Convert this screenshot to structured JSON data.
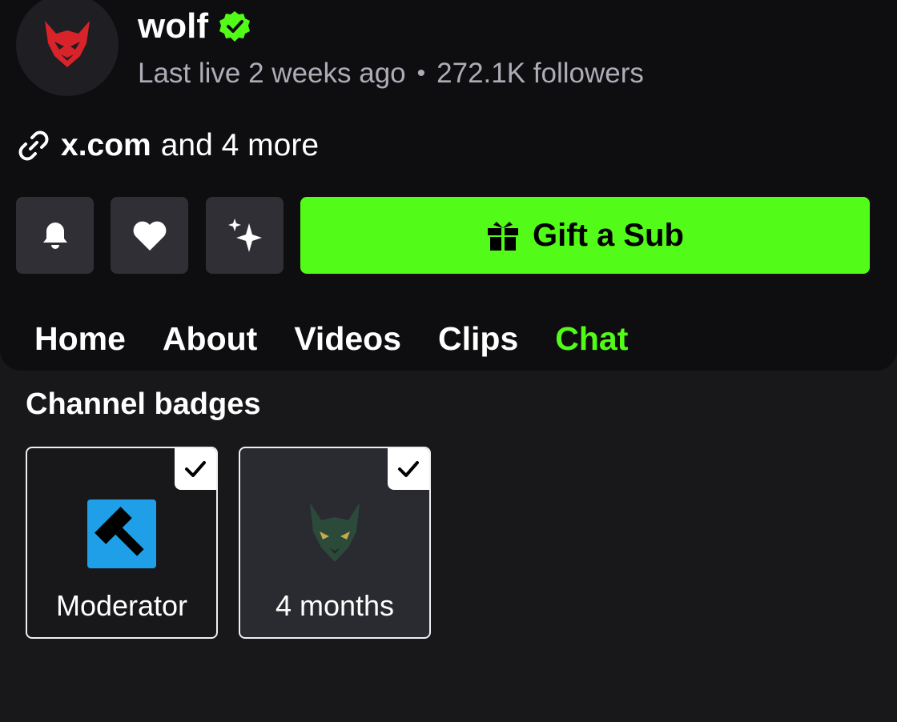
{
  "channel": {
    "name": "wolf",
    "last_live": "Last live 2 weeks ago",
    "separator": "•",
    "followers": "272.1K followers"
  },
  "links": {
    "primary": "x.com",
    "more": "and 4 more"
  },
  "actions": {
    "notify_icon": "bell-icon",
    "follow_icon": "heart-icon",
    "sparkle_icon": "sparkle-icon",
    "gift_label": "Gift a Sub",
    "gift_color": "#53fc18"
  },
  "tabs": [
    "Home",
    "About",
    "Videos",
    "Clips",
    "Chat"
  ],
  "active_tab": "Chat",
  "badges": {
    "title": "Channel badges",
    "items": [
      {
        "label": "Moderator",
        "icon": "hammer-icon",
        "selected": true
      },
      {
        "label": "4 months",
        "icon": "wolf-badge-icon",
        "selected": true
      }
    ]
  },
  "colors": {
    "accent": "#53fc18",
    "background": "#18181b",
    "header_bg": "#0e0e10",
    "button_bg": "#2f2f35"
  }
}
